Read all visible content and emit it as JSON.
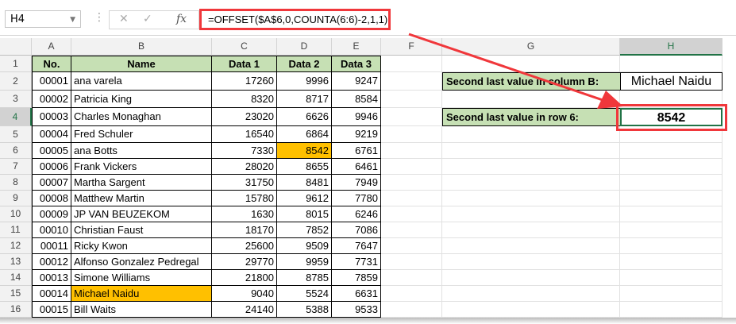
{
  "formula_bar": {
    "name_box": "H4",
    "cancel_icon": "✕",
    "enter_icon": "✓",
    "fx_label": "fx",
    "formula": "=OFFSET($A$6,0,COUNTA(6:6)-2,1,1)"
  },
  "columns": [
    "A",
    "B",
    "C",
    "D",
    "E",
    "F",
    "G",
    "H"
  ],
  "header_row": {
    "no": "No.",
    "name": "Name",
    "data1": "Data 1",
    "data2": "Data 2",
    "data3": "Data 3"
  },
  "rows": [
    [
      "00001",
      "ana varela",
      "17260",
      "9996",
      "9247"
    ],
    [
      "00002",
      "Patricia King",
      "8320",
      "8717",
      "8584"
    ],
    [
      "00003",
      "Charles Monaghan",
      "23020",
      "6626",
      "9946"
    ],
    [
      "00004",
      "Fred Schuler",
      "16540",
      "6864",
      "9219"
    ],
    [
      "00005",
      "ana Botts",
      "7330",
      "8542",
      "6761"
    ],
    [
      "00006",
      "Frank Vickers",
      "28020",
      "8655",
      "6461"
    ],
    [
      "00007",
      "Martha Sargent",
      "31750",
      "8481",
      "7949"
    ],
    [
      "00008",
      "Matthew Martin",
      "15780",
      "9612",
      "7780"
    ],
    [
      "00009",
      "JP VAN BEUZEKOM",
      "1630",
      "8015",
      "6246"
    ],
    [
      "00010",
      "Christian Faust",
      "18170",
      "7852",
      "7086"
    ],
    [
      "00011",
      "Ricky Kwon",
      "25600",
      "9509",
      "7647"
    ],
    [
      "00012",
      "Alfonso Gonzalez Pedregal",
      "29770",
      "9959",
      "7731"
    ],
    [
      "00013",
      "Simone Williams",
      "21800",
      "8785",
      "7859"
    ],
    [
      "00014",
      "Michael Naidu",
      "9040",
      "5524",
      "6631"
    ],
    [
      "00015",
      "Bill Waits",
      "24140",
      "5388",
      "9533"
    ]
  ],
  "results": {
    "col_b_label": "Second last value in column B:",
    "col_b_value": "Michael Naidu",
    "row6_label": "Second last value in row 6:",
    "row6_value": "8542"
  },
  "colors": {
    "header_fill": "#c6e0b4",
    "highlight": "#ffc000",
    "annotation": "#f0373b",
    "selection": "#217346"
  }
}
